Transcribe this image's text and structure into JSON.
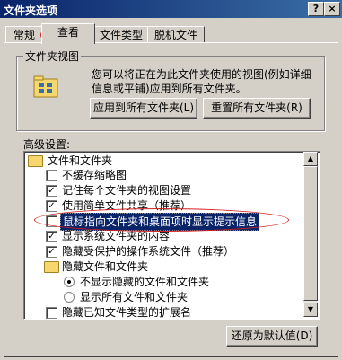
{
  "window": {
    "title": "文件夹选项",
    "help_btn": "?",
    "close_btn": "×"
  },
  "tabs": [
    {
      "label": "常规"
    },
    {
      "label": "查看"
    },
    {
      "label": "文件类型"
    },
    {
      "label": "脱机文件"
    }
  ],
  "folder_view": {
    "title": "文件夹视图",
    "description": "您可以将正在为此文件夹使用的视图(例如详细信息或平铺)应用到所有文件夹。",
    "apply_all_button": "应用到所有文件夹(L)",
    "reset_all_button": "重置所有文件夹(R)"
  },
  "advanced": {
    "label": "高级设置:",
    "items": [
      {
        "label": "文件和文件夹",
        "type": "folder"
      },
      {
        "label": "不缓存缩略图",
        "type": "checkbox",
        "checked": false
      },
      {
        "label": "记住每个文件夹的视图设置",
        "type": "checkbox",
        "checked": true
      },
      {
        "label": "使用简单文件共享（推荐）",
        "type": "checkbox",
        "checked": true
      },
      {
        "label": "鼠标指向文件夹和桌面项时显示提示信息",
        "type": "checkbox",
        "checked": false,
        "selected": true
      },
      {
        "label": "显示系统文件夹的内容",
        "type": "checkbox",
        "checked": true
      },
      {
        "label": "隐藏受保护的操作系统文件（推荐）",
        "type": "checkbox",
        "checked": true
      },
      {
        "label": "隐藏文件和文件夹",
        "type": "folder"
      },
      {
        "label": "不显示隐藏的文件和文件夹",
        "type": "radio",
        "checked": true
      },
      {
        "label": "显示所有文件和文件夹",
        "type": "radio",
        "checked": false
      },
      {
        "label": "隐藏已知文件类型的扩展名",
        "type": "checkbox",
        "checked": false
      }
    ],
    "restore_button": "还原为默认值(D)"
  }
}
